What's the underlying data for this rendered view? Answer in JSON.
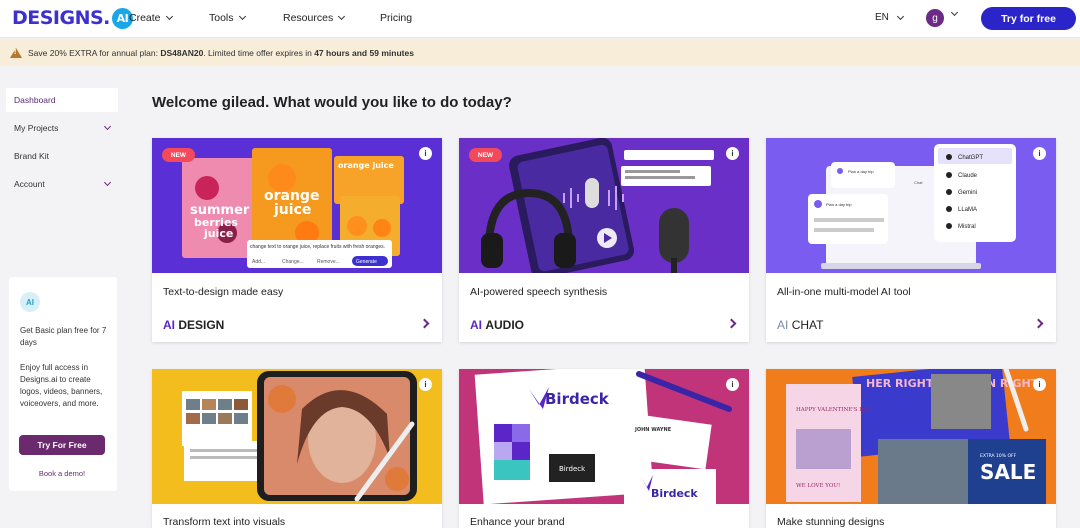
{
  "nav": {
    "logo_text": "DESIGNS.",
    "logo_ai": "AI",
    "links": [
      "Create",
      "Tools",
      "Resources",
      "Pricing"
    ],
    "language": "EN",
    "avatar_letter": "g",
    "try_button": "Try for free"
  },
  "promo": {
    "text_before": "Save 20% EXTRA for annual plan:",
    "code": "DS48AN20",
    "text_mid": ". Limited time offer expires in",
    "hours": "47 hours",
    "and": "and",
    "minutes": "59 minutes"
  },
  "sidebar": {
    "items": [
      "Dashboard",
      "My Projects",
      "Brand Kit",
      "Account"
    ],
    "promo": {
      "icon_text": "AI",
      "title": "Get Basic plan free for 7 days",
      "text": "Enjoy full access in Designs.ai to create logos, videos, banners, voiceovers, and more.",
      "button": "Try For Free",
      "link": "Book a demo!"
    }
  },
  "main": {
    "welcome": "Welcome gilead. What would you like to do today?",
    "cards": [
      {
        "desc": "Text-to-design made easy",
        "ai": "AI",
        "title": "DESIGN",
        "badge": "NEW"
      },
      {
        "desc": "AI-powered speech synthesis",
        "ai": "AI",
        "title": "AUDIO",
        "badge": "NEW"
      },
      {
        "desc": "All-in-one multi-model AI tool",
        "ai": "AI",
        "title": "CHAT"
      },
      {
        "desc": "Transform text into visuals"
      },
      {
        "desc": "Enhance your brand"
      },
      {
        "desc": "Make stunning designs"
      }
    ],
    "design_image": {
      "words": [
        "summer",
        "berries",
        "juice",
        "orange",
        "juice",
        "orange juice"
      ],
      "prompt": "change text to orange juice, replace fruits with fresh oranges.",
      "chips": [
        "Add...",
        "Change...",
        "Remove..."
      ],
      "generate": "Generate"
    },
    "chat_image": {
      "models": [
        "ChatGPT",
        "Claude",
        "Gemini",
        "LLaMA",
        "Mistral"
      ],
      "bubble1": "Plan a day trip",
      "bubble2": "Plan a day trip",
      "chat_label": "Chat"
    },
    "brand_image": {
      "brand": "Birdeck",
      "person": "JOHN WAYNE"
    },
    "stunning_image": {
      "poster1": "HER RIGHTS, HUMAN RIGHTS",
      "valentine": "HAPPY VALENTINE'S DAY",
      "love": "WE LOVE YOU!",
      "sale": "SALE",
      "sale_top": "EXTRA 10% OFF"
    }
  }
}
